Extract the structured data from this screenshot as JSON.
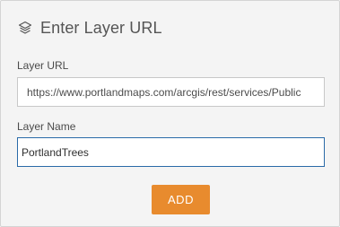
{
  "dialog": {
    "title": "Enter Layer URL",
    "title_icon": "layers-icon"
  },
  "layer_url": {
    "label": "Layer URL",
    "value": "https://www.portlandmaps.com/arcgis/rest/services/Public"
  },
  "layer_name": {
    "label": "Layer Name",
    "value": "PortlandTrees"
  },
  "actions": {
    "add_label": "ADD"
  },
  "colors": {
    "panel_background": "#f4f4f4",
    "accent_button": "#e88b2e",
    "focus_border": "#2a6aa8"
  }
}
